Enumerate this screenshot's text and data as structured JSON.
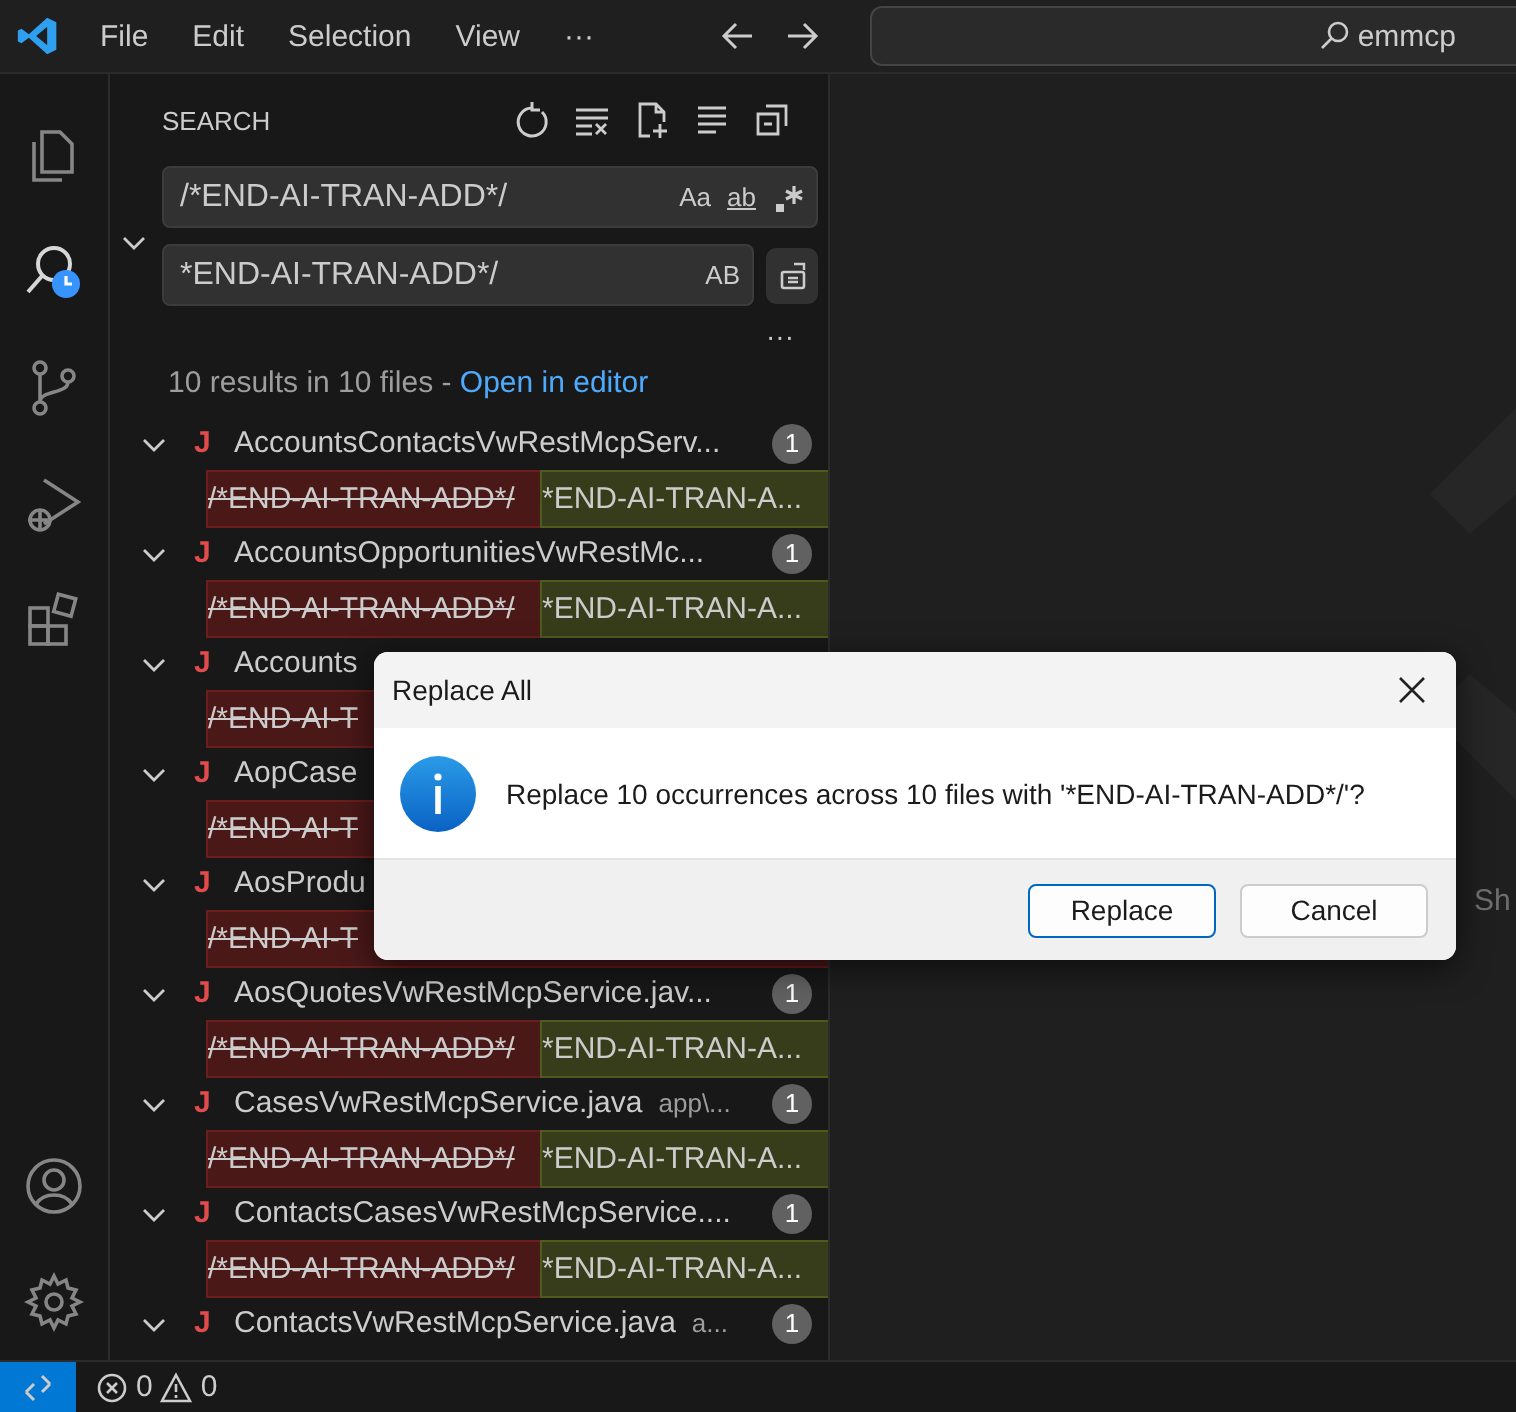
{
  "title_bar": {
    "menu": [
      "File",
      "Edit",
      "Selection",
      "View",
      "···"
    ],
    "command_center": "emmcp"
  },
  "activity_bar": {
    "top": [
      {
        "kind": "files",
        "selected": false
      },
      {
        "kind": "search",
        "selected": true
      },
      {
        "kind": "source-control",
        "selected": false
      },
      {
        "kind": "run-debug",
        "selected": false
      },
      {
        "kind": "extensions",
        "selected": false
      }
    ],
    "bottom": [
      {
        "kind": "account"
      },
      {
        "kind": "settings"
      }
    ]
  },
  "search_panel": {
    "title": "SEARCH",
    "replace_expanded": true,
    "search_value": "/*END-AI-TRAN-ADD*/",
    "match_case": "Aa",
    "whole_word": "ab",
    "replace_value": "*END-AI-TRAN-ADD*/",
    "preserve_case": "AB",
    "more": "···",
    "summary": "10 results in 10 files - ",
    "summary_link": "Open in editor",
    "results": [
      {
        "icon": "J",
        "file": "AccountsContactsVwRestMcpServ...",
        "count": "1",
        "expanded": true,
        "removed": "/*END-AI-TRAN-ADD*/",
        "added": "*END-AI-TRAN-A..."
      },
      {
        "icon": "J",
        "file": "AccountsOpportunitiesVwRestMc...",
        "count": "1",
        "expanded": true,
        "removed": "/*END-AI-TRAN-ADD*/",
        "added": "*END-AI-TRAN-A..."
      },
      {
        "icon": "J",
        "file": "Accounts",
        "expanded": true,
        "removed": "/*END-AI-T"
      },
      {
        "icon": "J",
        "file": "AopCase",
        "expanded": true,
        "removed": "/*END-AI-T"
      },
      {
        "icon": "J",
        "file": "AosProdu",
        "expanded": true,
        "removed": "/*END-AI-T"
      },
      {
        "icon": "J",
        "file": "AosQuotesVwRestMcpService.jav...",
        "count": "1",
        "expanded": true,
        "removed": "/*END-AI-TRAN-ADD*/",
        "added": "*END-AI-TRAN-A..."
      },
      {
        "icon": "J",
        "file": "CasesVwRestMcpService.java",
        "path": "app\\...",
        "count": "1",
        "expanded": true,
        "removed": "/*END-AI-TRAN-ADD*/",
        "added": "*END-AI-TRAN-A..."
      },
      {
        "icon": "J",
        "file": "ContactsCasesVwRestMcpService....",
        "count": "1",
        "expanded": true,
        "removed": "/*END-AI-TRAN-ADD*/",
        "added": "*END-AI-TRAN-A..."
      },
      {
        "icon": "J",
        "file": "ContactsVwRestMcpService.java",
        "path": "a...",
        "count": "1",
        "expanded": true
      }
    ]
  },
  "editor": {
    "hint": "Sh"
  },
  "dialog": {
    "title": "Replace All",
    "message": "Replace 10 occurrences across 10 files with '*END-AI-TRAN-ADD*/'?",
    "buttons": [
      {
        "label": "Replace",
        "default": true
      },
      {
        "label": "Cancel",
        "default": false
      }
    ]
  },
  "status_bar": {
    "errors": "0",
    "warnings": "0"
  }
}
